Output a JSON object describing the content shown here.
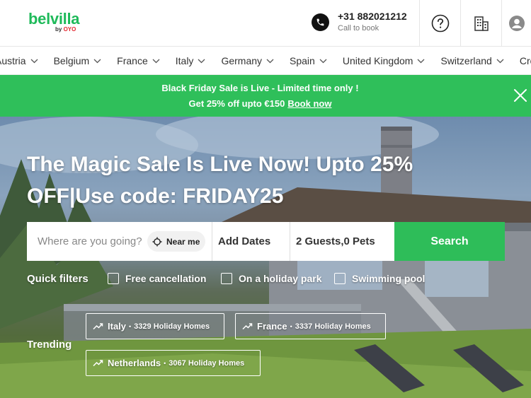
{
  "header": {
    "logo_text": "belvilla",
    "logo_by": "by",
    "logo_brand": "OYO",
    "phone_number": "+31 882021212",
    "phone_caption": "Call to book",
    "icons": [
      "phone-icon",
      "help-icon",
      "building-icon",
      "user-icon"
    ]
  },
  "country_nav": {
    "items": [
      {
        "label": "Austria"
      },
      {
        "label": "Belgium"
      },
      {
        "label": "France"
      },
      {
        "label": "Italy"
      },
      {
        "label": "Germany"
      },
      {
        "label": "Spain"
      },
      {
        "label": "United Kingdom"
      },
      {
        "label": "Switzerland"
      },
      {
        "label": "Cro"
      }
    ]
  },
  "promo": {
    "line1": "Black Friday Sale is Live - Limited time only !",
    "line2": "Get 25% off upto €150",
    "link": "Book now",
    "bg_color": "#2fbf5a"
  },
  "hero": {
    "title": "The Magic Sale Is Live Now! Upto 25% OFF|Use code: FRIDAY25"
  },
  "search": {
    "placeholder": "Where are you going?",
    "near_me": "Near me",
    "dates": "Add Dates",
    "guests": "2 Guests,0 Pets",
    "button": "Search",
    "button_color": "#2ebd59"
  },
  "quick_filters": {
    "label": "Quick filters",
    "items": [
      {
        "label": "Free cancellation"
      },
      {
        "label": "On a holiday park"
      },
      {
        "label": "Swimming pool"
      }
    ]
  },
  "trending": {
    "label": "Trending",
    "items": [
      {
        "name": "Italy",
        "count": "3329 Holiday Homes"
      },
      {
        "name": "France",
        "count": "3337 Holiday Homes"
      },
      {
        "name": "Netherlands",
        "count": "3067 Holiday Homes"
      }
    ]
  }
}
